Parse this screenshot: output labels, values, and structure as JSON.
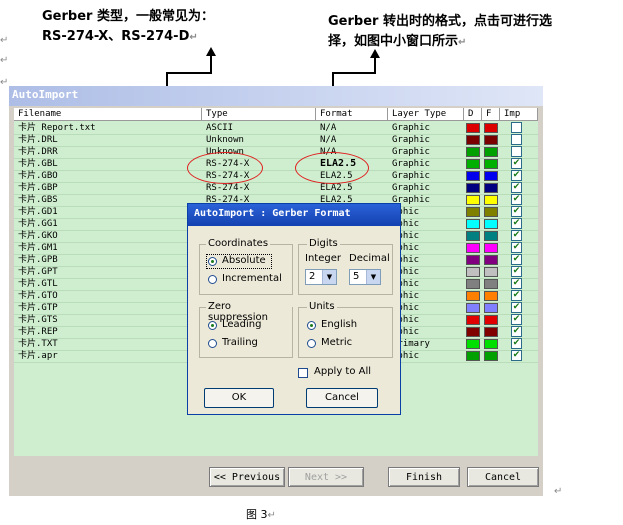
{
  "annotations": {
    "left_line1": "Gerber 类型，一般常见为：",
    "left_line2": "RS-274-X、RS-274-D",
    "right_line1": "Gerber 转出时的格式，点击可进行选",
    "right_line2": "择，如图中小窗口所示",
    "caption": "图 3",
    "para_mark": "↵"
  },
  "window": {
    "title": "AutoImport",
    "columns": [
      "Filename",
      "Type",
      "Format",
      "Layer Type",
      "D",
      "F",
      "Imp"
    ],
    "rows": [
      {
        "filename": "卡片 Report.txt",
        "type": "ASCII",
        "format": "N/A",
        "layer": "Graphic",
        "d": "#dd0000",
        "f": "#dd0000",
        "imp": false,
        "bold": false
      },
      {
        "filename": "卡片.DRL",
        "type": "Unknown",
        "format": "N/A",
        "layer": "Graphic",
        "d": "#7a0000",
        "f": "#7a0000",
        "imp": false,
        "bold": false
      },
      {
        "filename": "卡片.DRR",
        "type": "Unknown",
        "format": "N/A",
        "layer": "Graphic",
        "d": "#00a000",
        "f": "#00a000",
        "imp": false,
        "bold": false
      },
      {
        "filename": "卡片.GBL",
        "type": "RS-274-X",
        "format": "ELA2.5",
        "layer": "Graphic",
        "d": "#00b000",
        "f": "#00b000",
        "imp": true,
        "bold": true
      },
      {
        "filename": "卡片.GBO",
        "type": "RS-274-X",
        "format": "ELA2.5",
        "layer": "Graphic",
        "d": "#0000ee",
        "f": "#0000ee",
        "imp": true,
        "bold": false
      },
      {
        "filename": "卡片.GBP",
        "type": "RS-274-X",
        "format": "ELA2.5",
        "layer": "Graphic",
        "d": "#000080",
        "f": "#000080",
        "imp": true,
        "bold": false
      },
      {
        "filename": "卡片.GBS",
        "type": "RS-274-X",
        "format": "ELA2.5",
        "layer": "Graphic",
        "d": "#ffff00",
        "f": "#ffff00",
        "imp": true,
        "bold": false
      },
      {
        "filename": "卡片.GD1",
        "type": "",
        "format": "",
        "layer": "aphic",
        "d": "#808000",
        "f": "#808000",
        "imp": true,
        "bold": false
      },
      {
        "filename": "卡片.GG1",
        "type": "",
        "format": "",
        "layer": "aphic",
        "d": "#00ffff",
        "f": "#00ffff",
        "imp": true,
        "bold": false
      },
      {
        "filename": "卡片.GKO",
        "type": "",
        "format": "",
        "layer": "aphic",
        "d": "#008080",
        "f": "#008080",
        "imp": true,
        "bold": false
      },
      {
        "filename": "卡片.GM1",
        "type": "",
        "format": "",
        "layer": "aphic",
        "d": "#ff00ff",
        "f": "#ff00ff",
        "imp": true,
        "bold": false
      },
      {
        "filename": "卡片.GPB",
        "type": "",
        "format": "",
        "layer": "aphic",
        "d": "#800080",
        "f": "#800080",
        "imp": true,
        "bold": false
      },
      {
        "filename": "卡片.GPT",
        "type": "",
        "format": "",
        "layer": "aphic",
        "d": "#c0c0c0",
        "f": "#c0c0c0",
        "imp": true,
        "bold": false
      },
      {
        "filename": "卡片.GTL",
        "type": "",
        "format": "",
        "layer": "aphic",
        "d": "#808080",
        "f": "#808080",
        "imp": true,
        "bold": false
      },
      {
        "filename": "卡片.GTO",
        "type": "",
        "format": "",
        "layer": "aphic",
        "d": "#ff8000",
        "f": "#ff8000",
        "imp": true,
        "bold": false
      },
      {
        "filename": "卡片.GTP",
        "type": "",
        "format": "",
        "layer": "aphic",
        "d": "#8080ff",
        "f": "#8080ff",
        "imp": true,
        "bold": false
      },
      {
        "filename": "卡片.GTS",
        "type": "",
        "format": "",
        "layer": "aphic",
        "d": "#e00000",
        "f": "#e00000",
        "imp": true,
        "bold": false
      },
      {
        "filename": "卡片.REP",
        "type": "",
        "format": "",
        "layer": "aphic",
        "d": "#800000",
        "f": "#800000",
        "imp": true,
        "bold": false
      },
      {
        "filename": "卡片.TXT",
        "type": "",
        "format": "",
        "layer": "Primary",
        "d": "#00e000",
        "f": "#00e000",
        "imp": true,
        "bold": false
      },
      {
        "filename": "卡片.apr",
        "type": "",
        "format": "",
        "layer": "aphic",
        "d": "#00a000",
        "f": "#00a000",
        "imp": true,
        "bold": false
      }
    ],
    "buttons": {
      "previous": "<< Previous",
      "next": "Next >>",
      "finish": "Finish",
      "cancel": "Cancel"
    }
  },
  "dialog": {
    "title": "AutoImport : Gerber Format",
    "coordinates": {
      "label": "Coordinates",
      "absolute": "Absolute",
      "incremental": "Incremental",
      "selected": "absolute"
    },
    "digits": {
      "label": "Digits",
      "integer_label": "Integer",
      "decimal_label": "Decimal",
      "integer_value": "2",
      "decimal_value": "5"
    },
    "zero_suppression": {
      "label": "Zero suppression",
      "leading": "Leading",
      "trailing": "Trailing",
      "selected": "leading"
    },
    "units": {
      "label": "Units",
      "english": "English",
      "metric": "Metric",
      "selected": "english"
    },
    "apply_all": {
      "label": "Apply to All",
      "checked": false
    },
    "ok": "OK",
    "cancel": "Cancel"
  }
}
